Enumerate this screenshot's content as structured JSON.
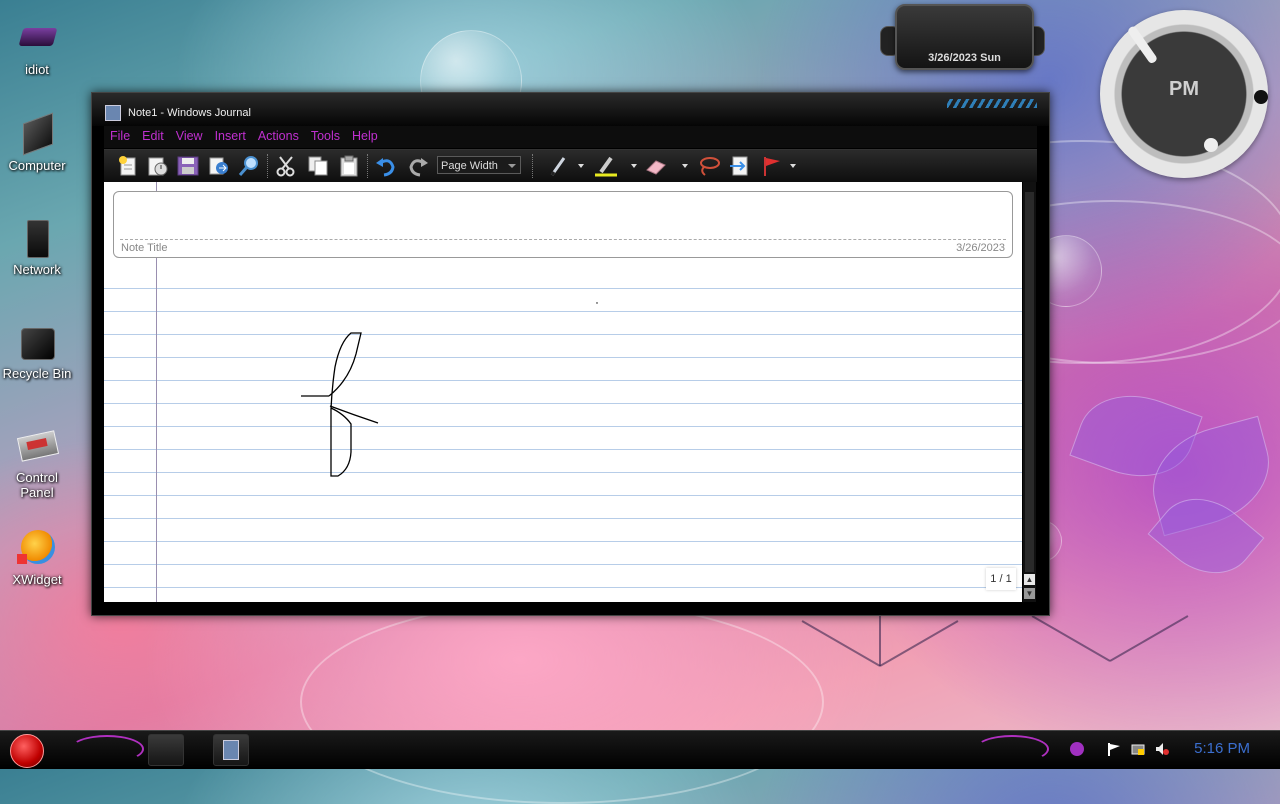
{
  "desktop": {
    "icons": [
      {
        "label": "idiot",
        "icon": "user-folder-icon"
      },
      {
        "label": "Computer",
        "icon": "computer-icon"
      },
      {
        "label": "Network",
        "icon": "network-icon"
      },
      {
        "label": "Recycle Bin",
        "icon": "recycle-bin-icon"
      },
      {
        "label": "Control Panel",
        "icon": "control-panel-icon"
      },
      {
        "label": "XWidget",
        "icon": "xwidget-icon"
      }
    ]
  },
  "gadgets": {
    "date": "3/26/2023 Sun",
    "clock_label": "PM"
  },
  "window": {
    "title": "Note1 - Windows Journal",
    "menu": [
      "File",
      "Edit",
      "View",
      "Insert",
      "Actions",
      "Tools",
      "Help"
    ],
    "toolbar": {
      "buttons": [
        "new-note-icon",
        "open-icon",
        "save-icon",
        "import-icon",
        "find-icon",
        "cut-icon",
        "copy-icon",
        "paste-icon",
        "undo-icon",
        "redo-icon"
      ],
      "zoom_value": "Page Width",
      "pen_tools": [
        "pen-icon",
        "highlighter-icon",
        "eraser-icon",
        "lasso-icon",
        "insert-space-icon",
        "flag-icon"
      ]
    },
    "note": {
      "title_placeholder": "Note Title",
      "date": "3/26/2023",
      "page_indicator": "1 / 1"
    }
  },
  "taskbar": {
    "time": "5:16 PM",
    "tray": [
      "action-center-flag-icon",
      "network-tray-icon",
      "volume-muted-icon"
    ]
  },
  "colors": {
    "menu_text": "#c030d0",
    "clock_text": "#3b6fd0",
    "ruled_line": "#b7cde8"
  }
}
